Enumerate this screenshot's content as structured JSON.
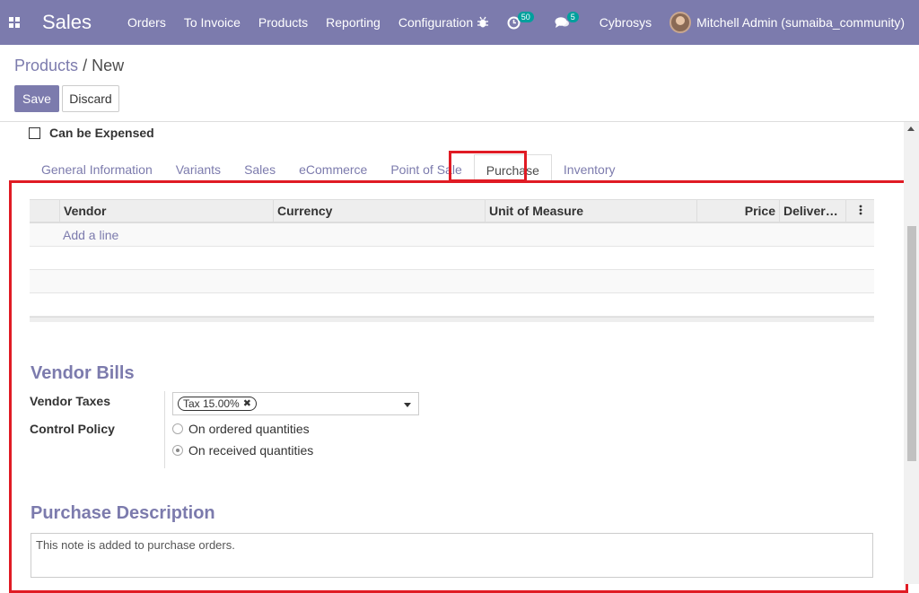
{
  "navbar": {
    "app_name": "Sales",
    "menu": [
      "Orders",
      "To Invoice",
      "Products",
      "Reporting",
      "Configuration"
    ],
    "activity_badge": "50",
    "messages_badge": "5",
    "company": "Cybrosys",
    "user": "Mitchell Admin (sumaiba_community)",
    "color": "#7c7bad"
  },
  "breadcrumb": {
    "parent": "Products",
    "separator": "/",
    "current": "New"
  },
  "buttons": {
    "save": "Save",
    "discard": "Discard"
  },
  "form": {
    "can_be_expensed_label": "Can be Expensed",
    "tabs": [
      {
        "label": "General Information"
      },
      {
        "label": "Variants"
      },
      {
        "label": "Sales"
      },
      {
        "label": "eCommerce"
      },
      {
        "label": "Point of Sale"
      },
      {
        "label": "Purchase",
        "active": true
      },
      {
        "label": "Inventory"
      }
    ],
    "vendor_table": {
      "columns": [
        "Vendor",
        "Currency",
        "Unit of Measure",
        "Price",
        "Delivery…"
      ],
      "add_line": "Add a line"
    },
    "vendor_bills": {
      "title": "Vendor Bills",
      "vendor_taxes_label": "Vendor Taxes",
      "tax_tag": "Tax 15.00%",
      "control_policy_label": "Control Policy",
      "policy_options": [
        "On ordered quantities",
        "On received quantities"
      ],
      "policy_selected": "On received quantities"
    },
    "purchase_description": {
      "title": "Purchase Description",
      "placeholder": "This note is added to purchase orders."
    }
  },
  "highlight_color": "#e01b24"
}
